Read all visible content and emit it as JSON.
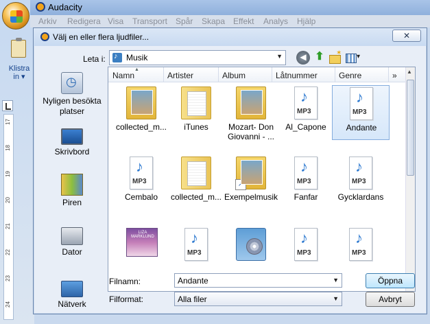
{
  "app": {
    "title": "Audacity",
    "menu": [
      "Arkiv",
      "Redigera",
      "Visa",
      "Transport",
      "Spår",
      "Skapa",
      "Effekt",
      "Analys",
      "Hjälp"
    ]
  },
  "background_app": {
    "paste_label": "Klistra\nin ▾",
    "ruler_numbers": [
      "17",
      "18",
      "19",
      "20",
      "21",
      "22",
      "23",
      "24"
    ]
  },
  "dialog": {
    "title": "Välj en eller flera ljudfiler...",
    "look_in_label": "Leta i:",
    "look_in_value": "Musik",
    "places": [
      "Nyligen besökta platser",
      "Skrivbord",
      "Piren",
      "Dator",
      "Nätverk"
    ],
    "columns": [
      "Namn",
      "Artister",
      "Album",
      "Låtnummer",
      "Genre"
    ],
    "more_columns": "»",
    "items": [
      {
        "label": "collected_m...",
        "icon": "folder-photo-icon"
      },
      {
        "label": "iTunes",
        "icon": "folder-icon"
      },
      {
        "label": "Mozart- Don Giovanni - ...",
        "icon": "folder-photo-icon"
      },
      {
        "label": "Al_Capone",
        "icon": "mp3-icon"
      },
      {
        "label": "Andante",
        "icon": "mp3-icon",
        "selected": true
      },
      {
        "label": "Cembalo",
        "icon": "mp3-icon"
      },
      {
        "label": "collected_m...",
        "icon": "folder-icon"
      },
      {
        "label": "Exempelmusik",
        "icon": "folder-shortcut-icon"
      },
      {
        "label": "Fanfar",
        "icon": "mp3-icon"
      },
      {
        "label": "Gycklardans",
        "icon": "mp3-icon"
      },
      {
        "label": "",
        "icon": "album-cover-icon"
      },
      {
        "label": "",
        "icon": "mp3-icon"
      },
      {
        "label": "",
        "icon": "installer-icon"
      },
      {
        "label": "",
        "icon": "mp3-icon"
      },
      {
        "label": "",
        "icon": "mp3-icon"
      }
    ],
    "filename_label": "Filnamn:",
    "filename_value": "Andante",
    "filetype_label": "Filformat:",
    "filetype_value": "Alla filer",
    "open_label": "Öppna",
    "cancel_label": "Avbryt",
    "close_label": "✕"
  },
  "colors": {
    "selection": "#d6e7fa",
    "accent": "#3c7fb1"
  }
}
